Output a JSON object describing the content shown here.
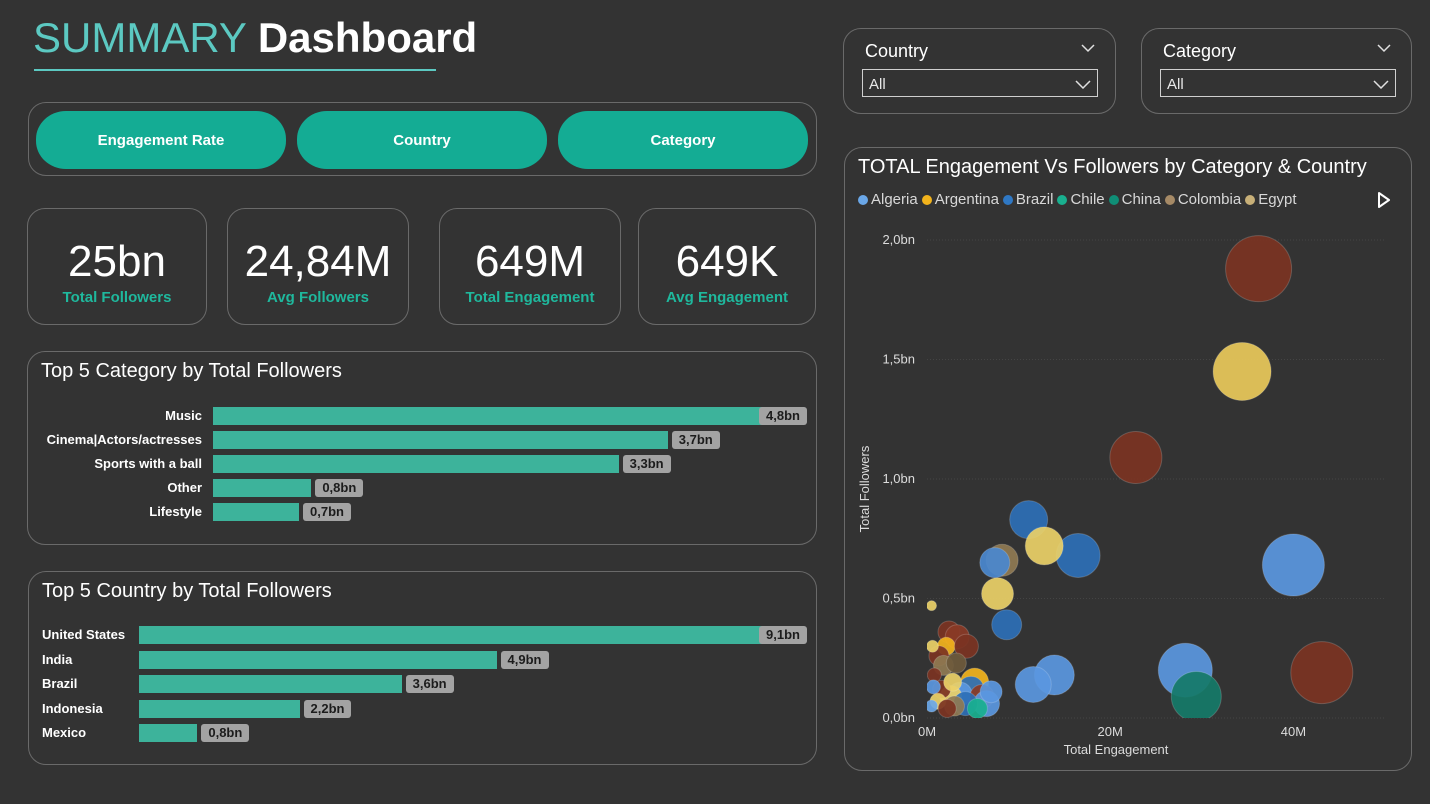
{
  "header": {
    "title_part1": "SUMMARY",
    "title_part2": "Dashboard"
  },
  "nav": {
    "buttons": [
      "Engagement Rate",
      "Country",
      "Category"
    ]
  },
  "kpis": [
    {
      "value": "25bn",
      "label": "Total Followers"
    },
    {
      "value": "24,84M",
      "label": "Avg Followers"
    },
    {
      "value": "649M",
      "label": "Total Engagement"
    },
    {
      "value": "649K",
      "label": "Avg Engagement"
    }
  ],
  "filters": {
    "country": {
      "title": "Country",
      "value": "All"
    },
    "category": {
      "title": "Category",
      "value": "All"
    }
  },
  "colors": {
    "accent": "#5cc9c2",
    "button": "#14ac94",
    "bar": "#3db39b",
    "kpi_label": "#1fb89d"
  },
  "chart_data": [
    {
      "type": "bar",
      "orientation": "horizontal",
      "title": "Top 5 Category by Total Followers",
      "categories": [
        "Music",
        "Cinema|Actors/actresses",
        "Sports with a ball",
        "Other",
        "Lifestyle"
      ],
      "values": [
        4.8,
        3.7,
        3.3,
        0.8,
        0.7
      ],
      "value_labels": [
        "4,8bn",
        "3,7bn",
        "3,3bn",
        "0,8bn",
        "0,7bn"
      ],
      "unit": "bn"
    },
    {
      "type": "bar",
      "orientation": "horizontal",
      "title": "Top 5 Country by Total Followers",
      "categories": [
        "United States",
        "India",
        "Brazil",
        "Indonesia",
        "Mexico"
      ],
      "values": [
        9.1,
        4.9,
        3.6,
        2.2,
        0.8
      ],
      "value_labels": [
        "9,1bn",
        "4,9bn",
        "3,6bn",
        "2,2bn",
        "0,8bn"
      ],
      "unit": "bn"
    },
    {
      "type": "scatter",
      "title": "TOTAL Engagement Vs Followers by Category & Country",
      "xlabel": "Total Engagement",
      "ylabel": "Total Followers",
      "xlim": [
        0,
        50
      ],
      "ylim": [
        0,
        2.0
      ],
      "x_ticks": [
        0,
        20,
        40
      ],
      "x_tick_labels": [
        "0M",
        "20M",
        "40M"
      ],
      "y_ticks": [
        0,
        0.5,
        1.0,
        1.5,
        2.0
      ],
      "y_tick_labels": [
        "0,0bn",
        "0,5bn",
        "1,0bn",
        "1,5bn",
        "2,0bn"
      ],
      "grid": true,
      "legend_position": "top",
      "legend": [
        {
          "name": "Algeria",
          "color": "#6aa7e8"
        },
        {
          "name": "Argentina",
          "color": "#f2b31c"
        },
        {
          "name": "Brazil",
          "color": "#2f78c4"
        },
        {
          "name": "Chile",
          "color": "#19b08f"
        },
        {
          "name": "China",
          "color": "#0f8e76"
        },
        {
          "name": "Colombia",
          "color": "#a68a66"
        },
        {
          "name": "Egypt",
          "color": "#c8b078"
        }
      ],
      "points": [
        {
          "x": 36.2,
          "y": 1.88,
          "r": 33,
          "color": "#7b3322"
        },
        {
          "x": 34.4,
          "y": 1.45,
          "r": 29,
          "color": "#e9c95a"
        },
        {
          "x": 22.8,
          "y": 1.09,
          "r": 26,
          "color": "#7b3322"
        },
        {
          "x": 43.1,
          "y": 0.19,
          "r": 31,
          "color": "#7b3322"
        },
        {
          "x": 40.0,
          "y": 0.64,
          "r": 31,
          "color": "#5a97df"
        },
        {
          "x": 28.2,
          "y": 0.2,
          "r": 27,
          "color": "#5a97df"
        },
        {
          "x": 29.4,
          "y": 0.09,
          "r": 25,
          "color": "#157a68"
        },
        {
          "x": 16.5,
          "y": 0.68,
          "r": 22,
          "color": "#2d6fb6"
        },
        {
          "x": 11.1,
          "y": 0.83,
          "r": 19,
          "color": "#2d6fb6"
        },
        {
          "x": 12.8,
          "y": 0.72,
          "r": 19,
          "color": "#ead067"
        },
        {
          "x": 8.2,
          "y": 0.66,
          "r": 16,
          "color": "#8f7a52"
        },
        {
          "x": 7.4,
          "y": 0.65,
          "r": 15,
          "color": "#4a88cf"
        },
        {
          "x": 7.7,
          "y": 0.52,
          "r": 16,
          "color": "#ead067"
        },
        {
          "x": 8.7,
          "y": 0.39,
          "r": 15,
          "color": "#2d6fb6"
        },
        {
          "x": 13.9,
          "y": 0.18,
          "r": 20,
          "color": "#5a97df"
        },
        {
          "x": 11.6,
          "y": 0.14,
          "r": 18,
          "color": "#5a97df"
        },
        {
          "x": 0.5,
          "y": 0.47,
          "r": 5,
          "color": "#ead067"
        },
        {
          "x": 2.4,
          "y": 0.36,
          "r": 11,
          "color": "#7b3322"
        },
        {
          "x": 3.3,
          "y": 0.34,
          "r": 12,
          "color": "#8a3a26"
        },
        {
          "x": 2.1,
          "y": 0.3,
          "r": 9,
          "color": "#f2b31c"
        },
        {
          "x": 4.3,
          "y": 0.3,
          "r": 12,
          "color": "#7b3322"
        },
        {
          "x": 1.3,
          "y": 0.26,
          "r": 10,
          "color": "#7b3322"
        },
        {
          "x": 0.6,
          "y": 0.3,
          "r": 6,
          "color": "#ead067"
        },
        {
          "x": 1.8,
          "y": 0.22,
          "r": 10,
          "color": "#8f7a52"
        },
        {
          "x": 3.2,
          "y": 0.23,
          "r": 10,
          "color": "#6e5a3c"
        },
        {
          "x": 0.8,
          "y": 0.18,
          "r": 7,
          "color": "#7b3322"
        },
        {
          "x": 5.2,
          "y": 0.15,
          "r": 14,
          "color": "#f2b31c"
        },
        {
          "x": 4.8,
          "y": 0.12,
          "r": 13,
          "color": "#2d6fb6"
        },
        {
          "x": 3.6,
          "y": 0.1,
          "r": 12,
          "color": "#5a97df"
        },
        {
          "x": 2.6,
          "y": 0.09,
          "r": 11,
          "color": "#ead067"
        },
        {
          "x": 1.6,
          "y": 0.12,
          "r": 9,
          "color": "#7b3322"
        },
        {
          "x": 0.7,
          "y": 0.13,
          "r": 7,
          "color": "#5a97df"
        },
        {
          "x": 6.0,
          "y": 0.09,
          "r": 12,
          "color": "#8a3a26"
        },
        {
          "x": 6.5,
          "y": 0.06,
          "r": 13,
          "color": "#5a97df"
        },
        {
          "x": 4.2,
          "y": 0.06,
          "r": 12,
          "color": "#2d6fb6"
        },
        {
          "x": 3.0,
          "y": 0.05,
          "r": 10,
          "color": "#8f7a52"
        },
        {
          "x": 1.2,
          "y": 0.07,
          "r": 8,
          "color": "#ead067"
        },
        {
          "x": 2.2,
          "y": 0.04,
          "r": 9,
          "color": "#7b3322"
        },
        {
          "x": 0.5,
          "y": 0.05,
          "r": 6,
          "color": "#6aa7e8"
        },
        {
          "x": 5.5,
          "y": 0.04,
          "r": 10,
          "color": "#19b08f"
        },
        {
          "x": 7.0,
          "y": 0.11,
          "r": 11,
          "color": "#5a97df"
        },
        {
          "x": 2.8,
          "y": 0.15,
          "r": 9,
          "color": "#ead067"
        }
      ]
    }
  ]
}
